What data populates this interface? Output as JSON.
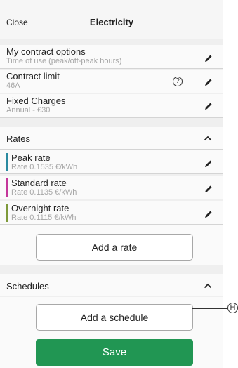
{
  "header": {
    "close_label": "Close",
    "title": "Electricity"
  },
  "contract": [
    {
      "label": "My contract options",
      "sub": "Time of use (peak/off-peak hours)"
    },
    {
      "label": "Contract limit",
      "sub": "46A",
      "help": "?"
    },
    {
      "label": "Fixed Charges",
      "sub": "Annual - €30"
    }
  ],
  "rates_section": {
    "title": "Rates"
  },
  "rates": [
    {
      "label": "Peak rate",
      "sub": "Rate 0.1535 €/kWh",
      "color": "#2a8aa0"
    },
    {
      "label": "Standard rate",
      "sub": "Rate 0.1135 €/kWh",
      "color": "#c4379a"
    },
    {
      "label": "Overnight rate",
      "sub": "Rate 0.1115 €/kWh",
      "color": "#7e9a3a"
    }
  ],
  "add_rate_label": "Add a rate",
  "schedules_section": {
    "title": "Schedules"
  },
  "add_schedule_label": "Add a schedule",
  "save_label": "Save",
  "callout_label": "H",
  "colors": {
    "save": "#219653",
    "background": "#efefef"
  },
  "icons": {
    "edit": "pencil-icon",
    "collapse": "chevron-up-icon",
    "help": "help-circle-icon"
  }
}
